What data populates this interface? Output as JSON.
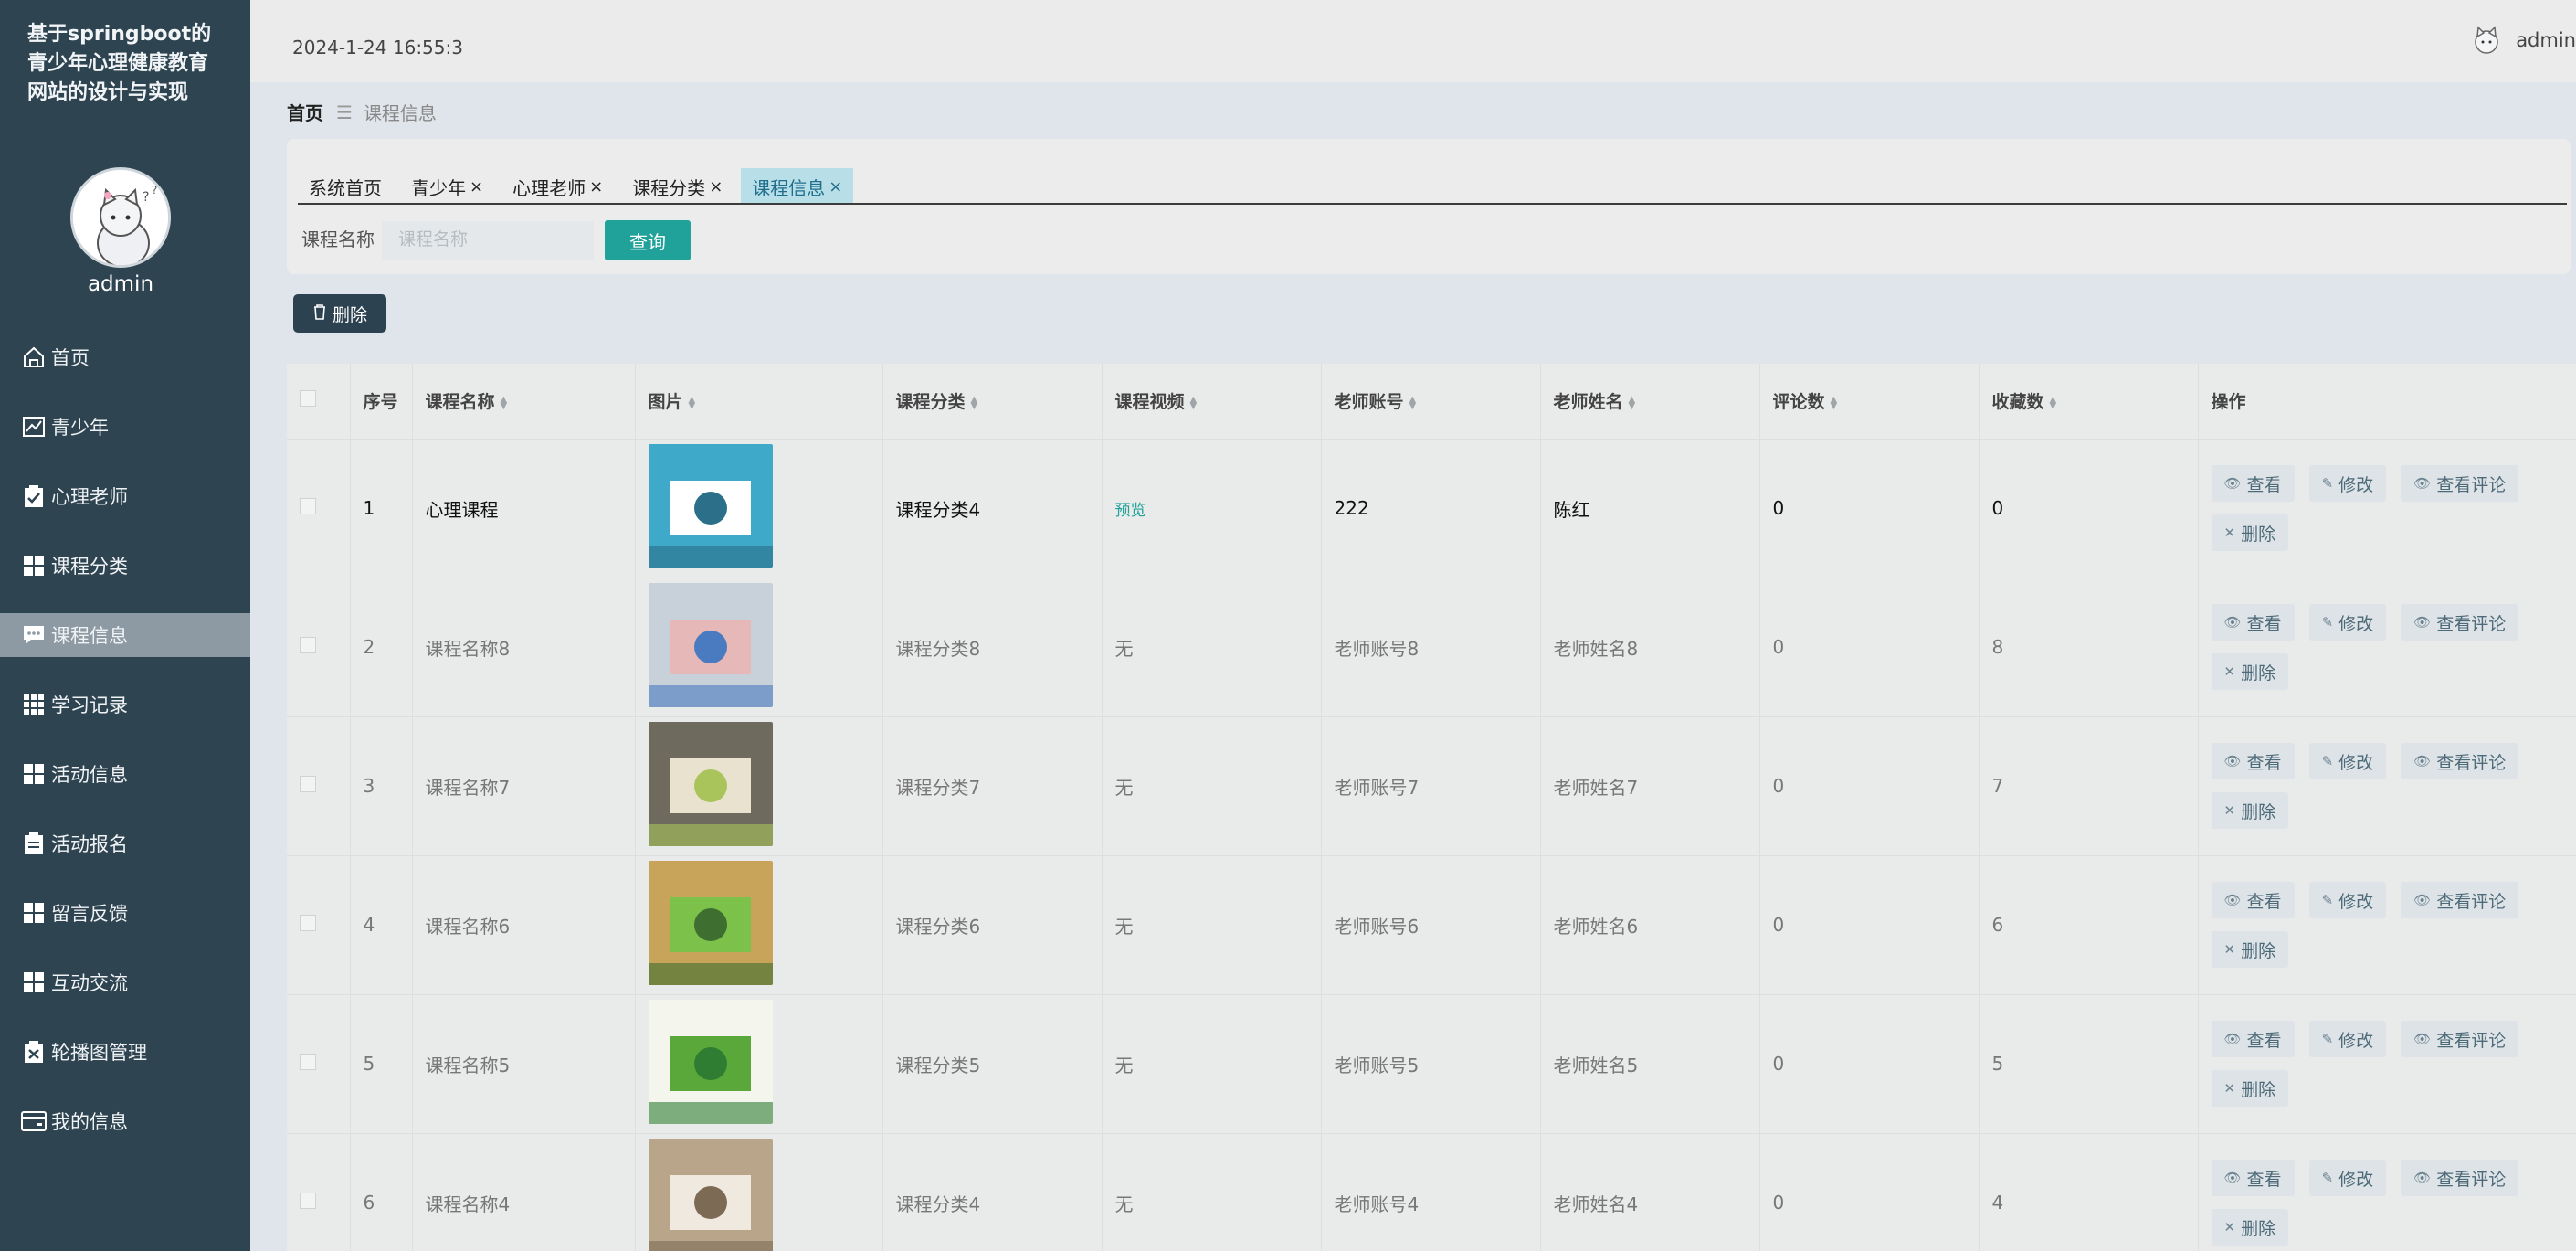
{
  "site": {
    "title": "基于springboot的青少年心理健康教育网站的设计与实现"
  },
  "sidebar": {
    "user": "admin",
    "items": [
      {
        "label": "首页",
        "icon": "home-icon"
      },
      {
        "label": "青少年",
        "icon": "chart-icon"
      },
      {
        "label": "心理老师",
        "icon": "clipboard-check-icon"
      },
      {
        "label": "课程分类",
        "icon": "grid-icon"
      },
      {
        "label": "课程信息",
        "icon": "chat-icon",
        "active": true
      },
      {
        "label": "学习记录",
        "icon": "grid9-icon"
      },
      {
        "label": "活动信息",
        "icon": "grid-icon"
      },
      {
        "label": "活动报名",
        "icon": "clipboard-icon"
      },
      {
        "label": "留言反馈",
        "icon": "grid-icon"
      },
      {
        "label": "互动交流",
        "icon": "grid-icon"
      },
      {
        "label": "轮播图管理",
        "icon": "clipboard-x-icon"
      },
      {
        "label": "我的信息",
        "icon": "card-icon"
      }
    ]
  },
  "header": {
    "datetime": "2024-1-24 16:55:3",
    "user": "admin"
  },
  "breadcrumb": {
    "home": "首页",
    "current": "课程信息"
  },
  "tabs": [
    {
      "label": "系统首页",
      "closable": false
    },
    {
      "label": "青少年",
      "closable": true
    },
    {
      "label": "心理老师",
      "closable": true
    },
    {
      "label": "课程分类",
      "closable": true
    },
    {
      "label": "课程信息",
      "closable": true,
      "active": true
    }
  ],
  "tab_close": "×",
  "search": {
    "label": "课程名称",
    "placeholder": "课程名称",
    "button": "查询"
  },
  "toolbar": {
    "delete_label": "删除"
  },
  "table": {
    "headers": [
      "序号",
      "课程名称",
      "图片",
      "课程分类",
      "课程视频",
      "老师账号",
      "老师姓名",
      "评论数",
      "收藏数",
      "操作"
    ],
    "actions": [
      "查看",
      "修改",
      "查看评论",
      "删除"
    ],
    "rows": [
      {
        "no": "1",
        "name": "心理课程",
        "category": "课程分类4",
        "video": "预览",
        "account": "222",
        "teacher": "陈红",
        "comments": "0",
        "favorites": "0"
      },
      {
        "no": "2",
        "name": "课程名称8",
        "category": "课程分类8",
        "video": "无",
        "account": "老师账号8",
        "teacher": "老师姓名8",
        "comments": "0",
        "favorites": "8"
      },
      {
        "no": "3",
        "name": "课程名称7",
        "category": "课程分类7",
        "video": "无",
        "account": "老师账号7",
        "teacher": "老师姓名7",
        "comments": "0",
        "favorites": "7"
      },
      {
        "no": "4",
        "name": "课程名称6",
        "category": "课程分类6",
        "video": "无",
        "account": "老师账号6",
        "teacher": "老师姓名6",
        "comments": "0",
        "favorites": "6"
      },
      {
        "no": "5",
        "name": "课程名称5",
        "category": "课程分类5",
        "video": "无",
        "account": "老师账号5",
        "teacher": "老师姓名5",
        "comments": "0",
        "favorites": "5"
      },
      {
        "no": "6",
        "name": "课程名称4",
        "category": "课程分类4",
        "video": "无",
        "account": "老师账号4",
        "teacher": "老师姓名4",
        "comments": "0",
        "favorites": "4"
      }
    ]
  },
  "colors": {
    "sidebar": "#2f4451",
    "accent": "#20a29a",
    "active_tab": "#b8dfe8"
  }
}
